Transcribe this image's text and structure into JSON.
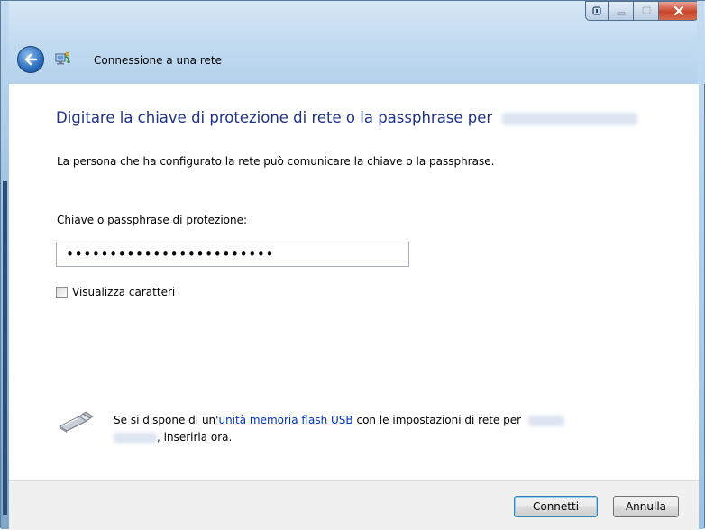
{
  "window": {
    "title": "Connessione a una rete",
    "caption_buttons": [
      "help",
      "minimize",
      "maximize",
      "close"
    ]
  },
  "header": {
    "heading": "Digitare la chiave di protezione di rete o la passphrase per"
  },
  "description": "La persona che ha configurato la rete può comunicare la chiave o la passphrase.",
  "security_key": {
    "label": "Chiave o passphrase di protezione:",
    "value": "••••••••••••••••••••••••"
  },
  "show_characters": {
    "label": "Visualizza caratteri",
    "checked": false
  },
  "usb_hint": {
    "text_before": "Se si dispone di un'",
    "link_text": "unità memoria flash USB",
    "text_after": " con le impostazioni di rete per",
    "text_end": ", inserirla ora."
  },
  "buttons": {
    "connect": "Connetti",
    "cancel": "Annulla"
  },
  "icons": {
    "back": "back-arrow-icon",
    "app": "network-connection-icon",
    "usb": "usb-flash-drive-icon"
  },
  "colors": {
    "heading": "#1e3287",
    "link": "#0033bb",
    "title_bar": "#c4dcf1",
    "close_button": "#c9452a"
  }
}
